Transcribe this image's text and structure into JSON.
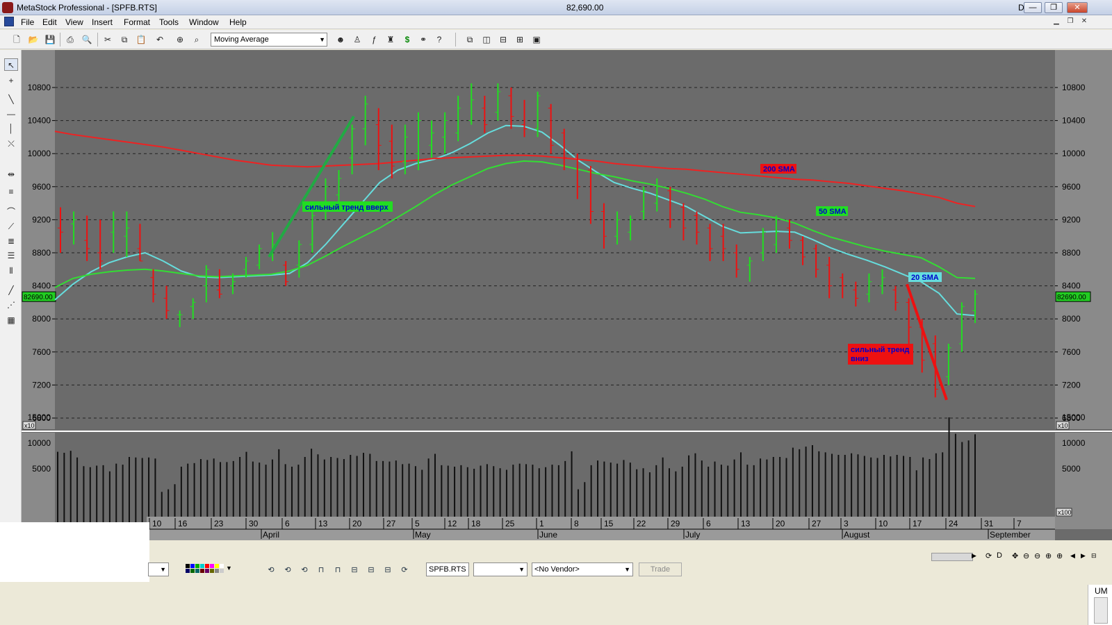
{
  "window": {
    "title": "MetaStock Professional - [SPFB.RTS]",
    "last_price": "82,690.00",
    "period": "Daily",
    "controls": [
      "—",
      "❐",
      "✕"
    ]
  },
  "menu": [
    "File",
    "Edit",
    "View",
    "Insert",
    "Format",
    "Tools",
    "Window",
    "Help"
  ],
  "toolbar": {
    "indicator_select": "Moving Average"
  },
  "bottom_toolbar": {
    "security": "SPFB.RTS",
    "period_select": "",
    "vendor": "<No Vendor>",
    "trade": "Trade"
  },
  "status": {
    "um": "UM"
  },
  "colors": {
    "chart_bg": "#6b6b6b",
    "up_bar": "#22dd22",
    "down_bar": "#ee1111",
    "sma20": "#66dddd",
    "sma50": "#33dd33",
    "sma200": "#ee2222",
    "volume_bar": "#111111"
  },
  "chart_data": [
    {
      "type": "ohlc",
      "title": "SPFB.RTS",
      "y_axis_multiplier": "x10",
      "ylim": [
        6700,
        10950
      ],
      "y_ticks": [
        6800,
        7200,
        7600,
        8000,
        8400,
        8800,
        9200,
        9600,
        10000,
        10400,
        10800
      ],
      "y_tick_labels": [
        "6800",
        "7200",
        "7600",
        "8000",
        "8400",
        "8800",
        "9200",
        "9600",
        "10000",
        "10400",
        "10800"
      ],
      "last_value_label": "82690.00",
      "last_value": 8269,
      "x_day_labels": [
        "10",
        "16",
        "23",
        "30",
        "6",
        "13",
        "20",
        "27",
        "5",
        "12",
        "18",
        "25",
        "1",
        "8",
        "15",
        "22",
        "29",
        "6",
        "13",
        "20",
        "27",
        "3",
        "10",
        "17",
        "24",
        "31",
        "7"
      ],
      "x_month_labels": [
        "April",
        "May",
        "June",
        "July",
        "August",
        "September"
      ],
      "grid": true,
      "series": [
        {
          "name": "20 SMA",
          "type": "line",
          "values": [
            8230,
            8420,
            8570,
            8680,
            8750,
            8800,
            8700,
            8580,
            8510,
            8500,
            8510,
            8520,
            8530,
            8550,
            8680,
            8900,
            9150,
            9400,
            9650,
            9800,
            9880,
            9930,
            10010,
            10120,
            10250,
            10340,
            10330,
            10260,
            10100,
            9920,
            9780,
            9650,
            9580,
            9520,
            9440,
            9360,
            9240,
            9120,
            9040,
            9050,
            9060,
            9050,
            8960,
            8860,
            8780,
            8710,
            8630,
            8540,
            8450,
            8310,
            8060,
            8040
          ]
        },
        {
          "name": "50 SMA",
          "type": "line",
          "values": [
            8380,
            8490,
            8540,
            8570,
            8590,
            8600,
            8580,
            8550,
            8520,
            8510,
            8520,
            8530,
            8540,
            8580,
            8650,
            8760,
            8880,
            8990,
            9100,
            9230,
            9360,
            9500,
            9620,
            9720,
            9820,
            9880,
            9910,
            9900,
            9860,
            9810,
            9760,
            9720,
            9670,
            9630,
            9580,
            9520,
            9450,
            9360,
            9290,
            9260,
            9220,
            9160,
            9070,
            8990,
            8930,
            8870,
            8820,
            8780,
            8740,
            8630,
            8500,
            8490
          ]
        },
        {
          "name": "200 SMA",
          "type": "line",
          "values": [
            10270,
            10230,
            10200,
            10170,
            10140,
            10110,
            10080,
            10040,
            10000,
            9960,
            9920,
            9890,
            9860,
            9850,
            9840,
            9850,
            9860,
            9870,
            9880,
            9900,
            9920,
            9940,
            9950,
            9960,
            9970,
            9980,
            9980,
            9970,
            9950,
            9930,
            9910,
            9880,
            9860,
            9840,
            9820,
            9810,
            9790,
            9770,
            9750,
            9730,
            9710,
            9690,
            9680,
            9660,
            9640,
            9610,
            9580,
            9550,
            9510,
            9470,
            9400,
            9360
          ]
        }
      ],
      "annotations": [
        {
          "text": "сильный тренд вверх",
          "color": "#22dd22",
          "text_color": "#0000cc"
        },
        {
          "text": "200 SMA",
          "color": "#ee1111",
          "text_color": "#0000cc"
        },
        {
          "text": "50 SMA",
          "color": "#22dd22",
          "text_color": "#0000cc"
        },
        {
          "text": "20 SMA",
          "color": "#66dddd",
          "text_color": "#0000cc"
        },
        {
          "text": "сильный тренд",
          "color": "#ee1111",
          "text_color": "#0000cc"
        },
        {
          "text": "вниз",
          "color": "#ee1111",
          "text_color": "#0000cc"
        }
      ],
      "trend_lines": [
        {
          "name": "uptrend",
          "color": "#22aa44",
          "from": [
            "Apr 3",
            8750
          ],
          "to": [
            "Apr 19",
            10450
          ]
        },
        {
          "name": "downtrend",
          "color": "#ee1111",
          "from": [
            "Aug 14",
            8420
          ],
          "to": [
            "Aug 26",
            7020
          ]
        }
      ],
      "ohlc": {
        "high": [
          9350,
          9300,
          9250,
          9200,
          9300,
          9300,
          9150,
          8600,
          8400,
          8100,
          8250,
          8650,
          8600,
          8550,
          8750,
          8900,
          9050,
          8700,
          8950,
          9350,
          9700,
          9800,
          10350,
          10700,
          10550,
          10350,
          10350,
          10500,
          10400,
          10500,
          10700,
          10850,
          10700,
          10850,
          10800,
          10650,
          10750,
          10600,
          10300,
          10000,
          9850,
          9400,
          9300,
          9250,
          9600,
          9700,
          9600,
          9400,
          9300,
          9150,
          9150,
          8900,
          8750,
          9100,
          9250,
          9200,
          9000,
          8900,
          8750,
          8550,
          8450,
          8550,
          8600,
          8400,
          8250,
          8000,
          7800,
          7700,
          8200,
          8350
        ],
        "low": [
          8800,
          8900,
          8700,
          8600,
          8800,
          8750,
          8700,
          8200,
          8000,
          7900,
          8000,
          8200,
          8250,
          8300,
          8500,
          8600,
          8700,
          8400,
          8500,
          8800,
          9200,
          9400,
          9750,
          10100,
          9800,
          9700,
          9750,
          9800,
          9950,
          10000,
          10150,
          10350,
          10250,
          10400,
          10300,
          10200,
          10200,
          10000,
          9800,
          9450,
          9150,
          8850,
          8900,
          8950,
          9200,
          9300,
          9100,
          8950,
          8900,
          8700,
          8700,
          8500,
          8450,
          8700,
          8800,
          8850,
          8650,
          8500,
          8250,
          8250,
          8150,
          8200,
          8300,
          8100,
          7600,
          7350,
          7050,
          7200,
          7600,
          7950
        ],
        "open": [
          9100,
          9150,
          8950,
          8800,
          9050,
          9000,
          8850,
          8500,
          8250,
          8050,
          8150,
          8400,
          8350,
          8400,
          8600,
          8650,
          8800,
          8650,
          8650,
          8900,
          9300,
          9500,
          9950,
          10300,
          10350,
          10150,
          9900,
          10000,
          10100,
          10200,
          10250,
          10400,
          10550,
          10500,
          10700,
          10350,
          10300,
          10550,
          10250,
          9950,
          9800,
          9300,
          9000,
          9050,
          9300,
          9400,
          9550,
          9350,
          9250,
          9100,
          9000,
          8800,
          8650,
          8800,
          8900,
          9100,
          8950,
          8850,
          8650,
          8500,
          8350,
          8300,
          8400,
          8350,
          8200,
          7900,
          7700,
          7300,
          7700,
          8100
        ],
        "close": [
          9050,
          9200,
          8850,
          8700,
          9200,
          9100,
          8700,
          8300,
          8100,
          8050,
          8200,
          8600,
          8300,
          8450,
          8700,
          8850,
          8900,
          8450,
          8900,
          9250,
          9600,
          9700,
          10300,
          10600,
          10100,
          9850,
          10200,
          10400,
          10250,
          10400,
          10550,
          10650,
          10350,
          10750,
          10450,
          10300,
          10700,
          10100,
          9950,
          9600,
          9300,
          9000,
          9200,
          9200,
          9550,
          9600,
          9200,
          9100,
          9050,
          8850,
          8850,
          8600,
          8700,
          9050,
          9050,
          8950,
          8750,
          8600,
          8400,
          8400,
          8250,
          8450,
          8500,
          8200,
          7900,
          7500,
          7150,
          7650,
          8150,
          8300
        ]
      }
    },
    {
      "type": "bar",
      "title": "Volume",
      "y_axis_multiplier": "x100",
      "ylim": [
        0,
        17000
      ],
      "y_ticks": [
        5000,
        10000,
        15000
      ],
      "y_tick_labels": [
        "5000",
        "10000",
        "15000"
      ],
      "values": [
        8300,
        8100,
        8500,
        7200,
        5500,
        5300,
        5600,
        5700,
        4500,
        6000,
        5800,
        7300,
        7200,
        7100,
        7200,
        7000,
        500,
        1000,
        2000,
        5400,
        6000,
        6100,
        6900,
        6700,
        7000,
        6300,
        6300,
        6500,
        7300,
        8300,
        6400,
        6200,
        5800,
        6800,
        8800,
        5900,
        5400,
        5800,
        7300,
        8900,
        7800,
        6800,
        7300,
        7100,
        6900,
        7700,
        7500,
        8100,
        7900,
        6500,
        6500,
        6400,
        6600,
        5900,
        6000,
        5500,
        4800,
        7000,
        7900,
        5700,
        5600,
        5400,
        5700,
        5300,
        5000,
        5600,
        5900,
        5500,
        5100,
        4800,
        5800,
        6000,
        5900,
        5800,
        5100,
        5300,
        5800,
        5700,
        6500,
        8400,
        1000,
        2400,
        5700,
        6600,
        6400,
        6200,
        6000,
        6700,
        6200,
        4900,
        5100,
        4300,
        5700,
        7200,
        5100,
        4500,
        5400,
        7600,
        8000,
        6600,
        5400,
        6400,
        5800,
        5600,
        6800,
        8200,
        5800,
        5700,
        7000,
        6800,
        7300,
        7300,
        7100,
        9100,
        8800,
        9300,
        9600,
        8400,
        8200,
        7900,
        7700,
        7700,
        8000,
        7800,
        7500,
        7200,
        7100,
        7700,
        7400,
        7700,
        7500,
        7300,
        4700,
        7200,
        6900,
        8000,
        8200,
        15000,
        11800,
        10200,
        10500,
        11700
      ]
    }
  ]
}
